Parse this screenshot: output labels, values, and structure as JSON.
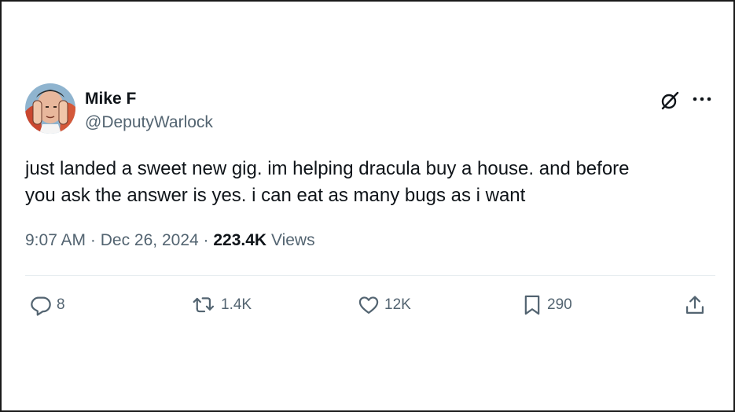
{
  "author": {
    "name": "Mike F",
    "handle": "@DeputyWarlock"
  },
  "tweet": {
    "text": "just landed a sweet new gig. im helping dracula buy a house. and before\nyou ask the answer is yes. i can eat as many bugs as i want",
    "time": "9:07 AM",
    "separator": "·",
    "date": "Dec 26, 2024",
    "views_count": "223.4K",
    "views_label": "Views"
  },
  "actions": {
    "replies": "8",
    "retweets": "1.4K",
    "likes": "12K",
    "bookmarks": "290"
  },
  "icons": {
    "reply": "reply-icon",
    "retweet": "retweet-icon",
    "like": "heart-icon",
    "bookmark": "bookmark-icon",
    "share": "share-icon",
    "grok": "grok-icon",
    "more": "more-icon"
  },
  "colors": {
    "text": "#0f1419",
    "secondary": "#536471",
    "divider": "#e6ecf0"
  }
}
